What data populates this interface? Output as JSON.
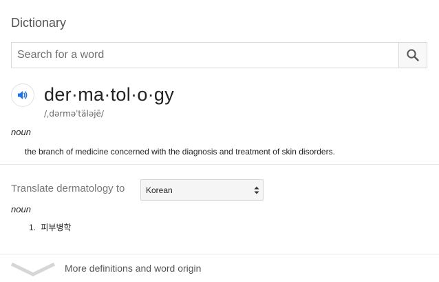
{
  "header": {
    "title": "Dictionary"
  },
  "search": {
    "placeholder": "Search for a word",
    "value": ""
  },
  "entry": {
    "headword": "der·ma·tol·o·gy",
    "phonetic": "/ˌdərməˈtäləjē/",
    "part_of_speech": "noun",
    "definition": "the branch of medicine concerned with the diagnosis and treatment of skin disorders."
  },
  "translate": {
    "label": "Translate dermatology to",
    "selected_language": "Korean",
    "part_of_speech": "noun",
    "items": [
      {
        "number": "1.",
        "text": "피부병학"
      }
    ]
  },
  "footer": {
    "more_label": "More definitions and word origin"
  },
  "icons": {
    "search": "search-icon",
    "speaker": "speaker-icon",
    "select_arrows": "select-arrows-icon",
    "chevron": "chevron-down-icon"
  },
  "colors": {
    "accent_blue": "#1a73e8",
    "divider": "#e8e8e8",
    "muted_text": "#777777"
  }
}
